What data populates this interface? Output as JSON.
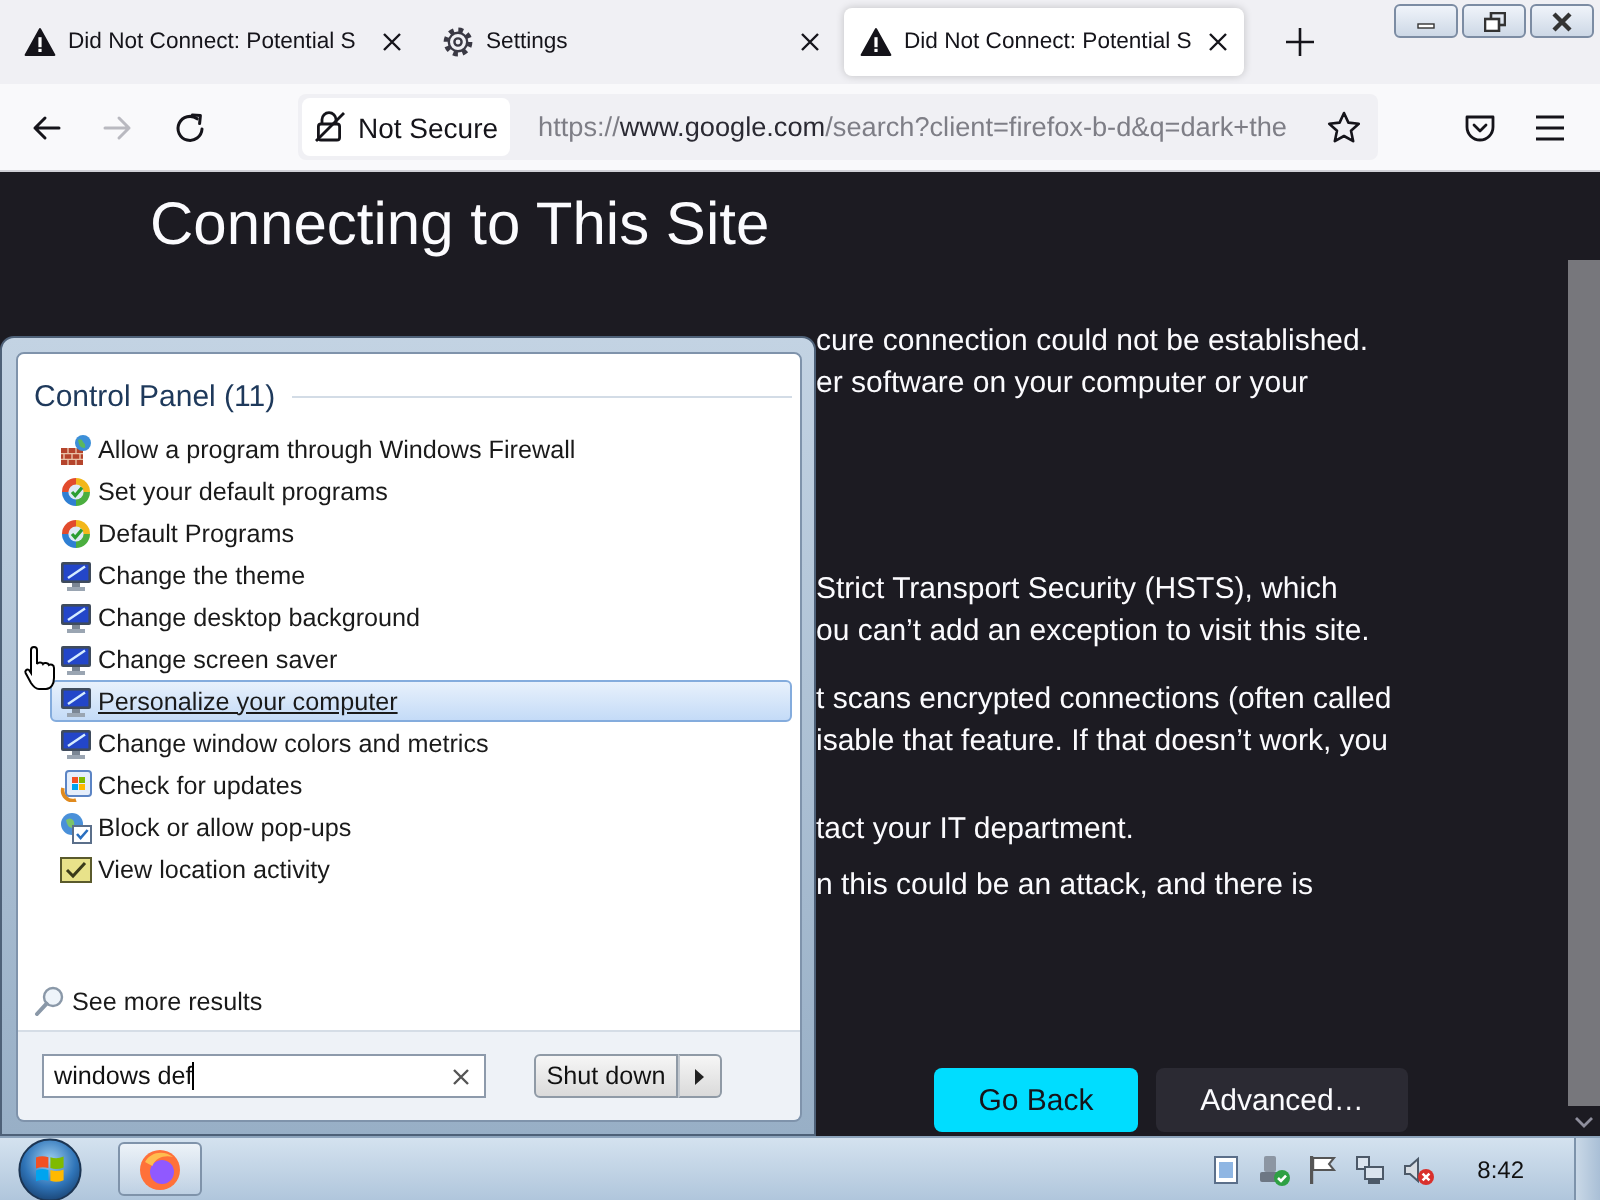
{
  "browser": {
    "tabs": [
      {
        "kind": "warning",
        "title": "Did Not Connect: Potential S",
        "selected": false
      },
      {
        "kind": "settings",
        "title": "Settings",
        "selected": false
      },
      {
        "kind": "warning",
        "title": "Did Not Connect: Potential S",
        "selected": true
      }
    ],
    "nav_buttons": [
      {
        "kind": "back",
        "disabled": false
      },
      {
        "kind": "forward",
        "disabled": true
      },
      {
        "kind": "reload",
        "disabled": false
      }
    ],
    "address_bar": {
      "security_label": "Not Secure",
      "url": {
        "scheme": "https://",
        "host": "www.google.com",
        "path": "/search?client=firefox-b-d&q=dark+the"
      }
    }
  },
  "page": {
    "heading": "Connecting to This Site",
    "paragraphs": [
      {
        "lines": [
          "cure connection could not be established.",
          "er software on your computer or your"
        ]
      },
      {
        "lines": [
          "Strict Transport Security (HSTS), which",
          "ou can’t add an exception to visit this site."
        ]
      },
      {
        "lines": [
          "t scans encrypted connections (often called",
          "isable that feature. If that doesn’t work, you"
        ]
      },
      {
        "lines": [
          "tact your IT department."
        ]
      },
      {
        "lines": [
          "n this could be an attack, and there is"
        ]
      }
    ],
    "buttons": [
      {
        "kind": "primary",
        "label": "Go Back"
      },
      {
        "kind": "secondary",
        "label": "Advanced…"
      }
    ]
  },
  "start_menu": {
    "group_title": "Control Panel (11)",
    "results": [
      {
        "kind": "firewall",
        "label": "Allow a program through Windows Firewall",
        "selected": false
      },
      {
        "kind": "programs",
        "label": "Set your default programs",
        "selected": false
      },
      {
        "kind": "programs",
        "label": "Default Programs",
        "selected": false
      },
      {
        "kind": "display",
        "label": "Change the theme",
        "selected": false
      },
      {
        "kind": "display",
        "label": "Change desktop background",
        "selected": false
      },
      {
        "kind": "display",
        "label": "Change screen saver",
        "selected": false
      },
      {
        "kind": "display",
        "label": "Personalize your computer",
        "selected": true
      },
      {
        "kind": "display",
        "label": "Change window colors and metrics",
        "selected": false
      },
      {
        "kind": "update",
        "label": "Check for updates",
        "selected": false
      },
      {
        "kind": "popup",
        "label": "Block or allow pop-ups",
        "selected": false
      },
      {
        "kind": "location",
        "label": "View location activity",
        "selected": false
      }
    ],
    "see_more": "See more results",
    "search": {
      "value": "windows def"
    },
    "shutdown_label": "Shut down"
  },
  "taskbar": {
    "clock": "8:42"
  }
}
